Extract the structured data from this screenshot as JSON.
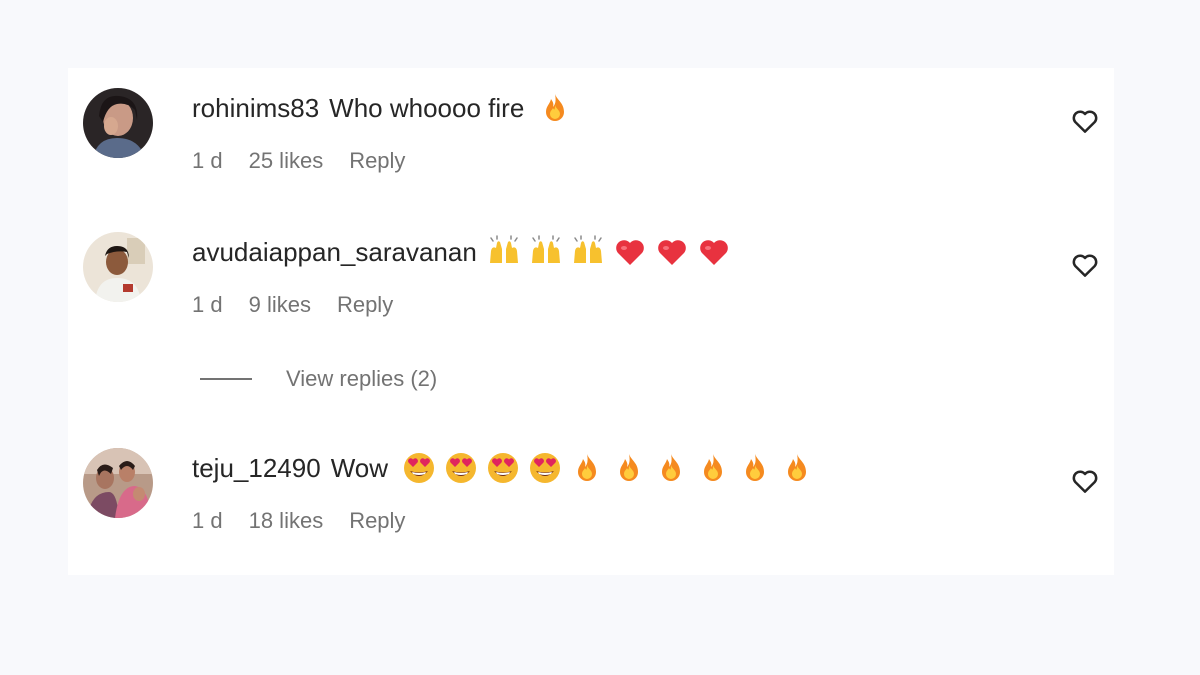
{
  "comments": [
    {
      "username": "rohinims83",
      "text": "Who whoooo fire",
      "emojis": [
        "fire"
      ],
      "time": "1 d",
      "likes": "25 likes",
      "reply_label": "Reply"
    },
    {
      "username": "avudaiappan_saravanan",
      "text": "",
      "emojis": [
        "raising-hands",
        "raising-hands",
        "raising-hands",
        "red-heart",
        "red-heart",
        "red-heart"
      ],
      "time": "1 d",
      "likes": "9 likes",
      "reply_label": "Reply",
      "view_replies_label": "View replies (2)"
    },
    {
      "username": "teju_12490",
      "text": "Wow",
      "emojis": [
        "heart-eyes",
        "heart-eyes",
        "heart-eyes",
        "heart-eyes",
        "fire",
        "fire",
        "fire",
        "fire",
        "fire",
        "fire"
      ],
      "time": "1 d",
      "likes": "18 likes",
      "reply_label": "Reply"
    }
  ],
  "icons": {
    "like": "heart-outline-icon"
  },
  "colors": {
    "text_primary": "#262626",
    "text_secondary": "#737373",
    "background": "#f8f9fc",
    "panel": "#ffffff"
  }
}
